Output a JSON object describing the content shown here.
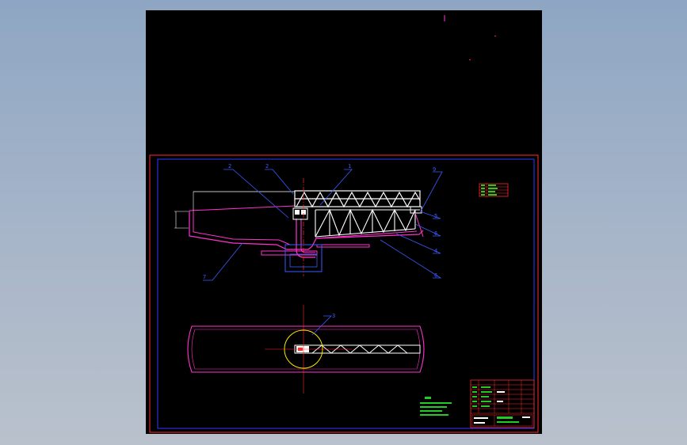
{
  "viewer": {
    "background": "#9fb0c6"
  },
  "drawing": {
    "sheet_color": "#000000",
    "frame_color": "#ff2a2a",
    "border_color": "#2a3cff",
    "section_color": "#ffffff",
    "vessel_color": "#ff33cc",
    "leader_color": "#3a5bff",
    "detail_circle_color": "#ffe600",
    "note_color": "#22cc22",
    "part_labels": [
      "2",
      "2",
      "1",
      "9",
      "5",
      "6",
      "4",
      "6",
      "7",
      "3"
    ],
    "detail_label": "3"
  }
}
